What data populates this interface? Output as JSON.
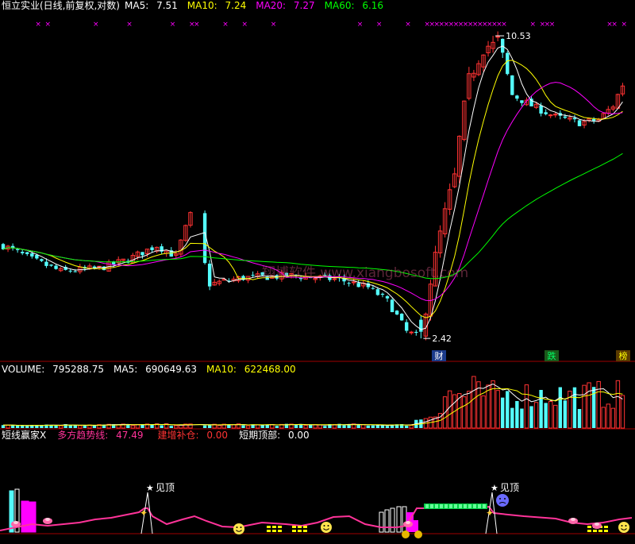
{
  "colors": {
    "up": "#ff3333",
    "down": "#54fcfc",
    "ma5": "#ffffff",
    "ma10": "#ffff00",
    "ma20": "#ff00ff",
    "ma60": "#00ff00",
    "grid": "#a00000",
    "white": "#ffffff",
    "magenta": "#ff00ff",
    "yellow": "#ffff00",
    "red": "#ff3333",
    "pink": "#ff3399"
  },
  "price_panel": {
    "title": "恒立实业(日线,前复权,对数)",
    "ma5": {
      "label": "MA5:",
      "value": "7.51"
    },
    "ma10": {
      "label": "MA10:",
      "value": "7.24"
    },
    "ma20": {
      "label": "MA20:",
      "value": "7.27"
    },
    "ma60": {
      "label": "MA60:",
      "value": "6.16"
    },
    "high_label": "10.53",
    "low_label": "2.42",
    "tags": [
      "财",
      "跌",
      "榜"
    ]
  },
  "volume_panel": {
    "vol": {
      "label": "VOLUME:",
      "value": "795288.75"
    },
    "ma5": {
      "label": "MA5:",
      "value": "690649.63"
    },
    "ma10": {
      "label": "MA10:",
      "value": "622468.00"
    }
  },
  "indicator_panel": {
    "title": "短线赢家X",
    "trend": {
      "label": "多方趋势线:",
      "value": "47.49"
    },
    "add": {
      "label": "建增补仓:",
      "value": "0.00"
    },
    "top": {
      "label": "短期顶部:",
      "value": "0.00"
    },
    "signal_labels": [
      "见顶",
      "见顶"
    ]
  },
  "watermark": "翔博软件 www.xiangbosoft.com",
  "chart_data": {
    "type": "candlestick",
    "title": "恒立实业(日线,前复权,对数)",
    "series": [
      {
        "name": "MA5",
        "last": 7.51
      },
      {
        "name": "MA10",
        "last": 7.24
      },
      {
        "name": "MA20",
        "last": 7.27
      },
      {
        "name": "MA60",
        "last": 6.16
      }
    ],
    "annotations": {
      "max_price": 10.53,
      "min_price": 2.42
    },
    "volume": {
      "last": 795288.75,
      "ma5": 690649.63,
      "ma10": 622468.0
    },
    "indicator": {
      "name": "短线赢家X",
      "多方趋势线": 47.49,
      "建增补仓": 0.0,
      "短期顶部": 0.0
    }
  }
}
